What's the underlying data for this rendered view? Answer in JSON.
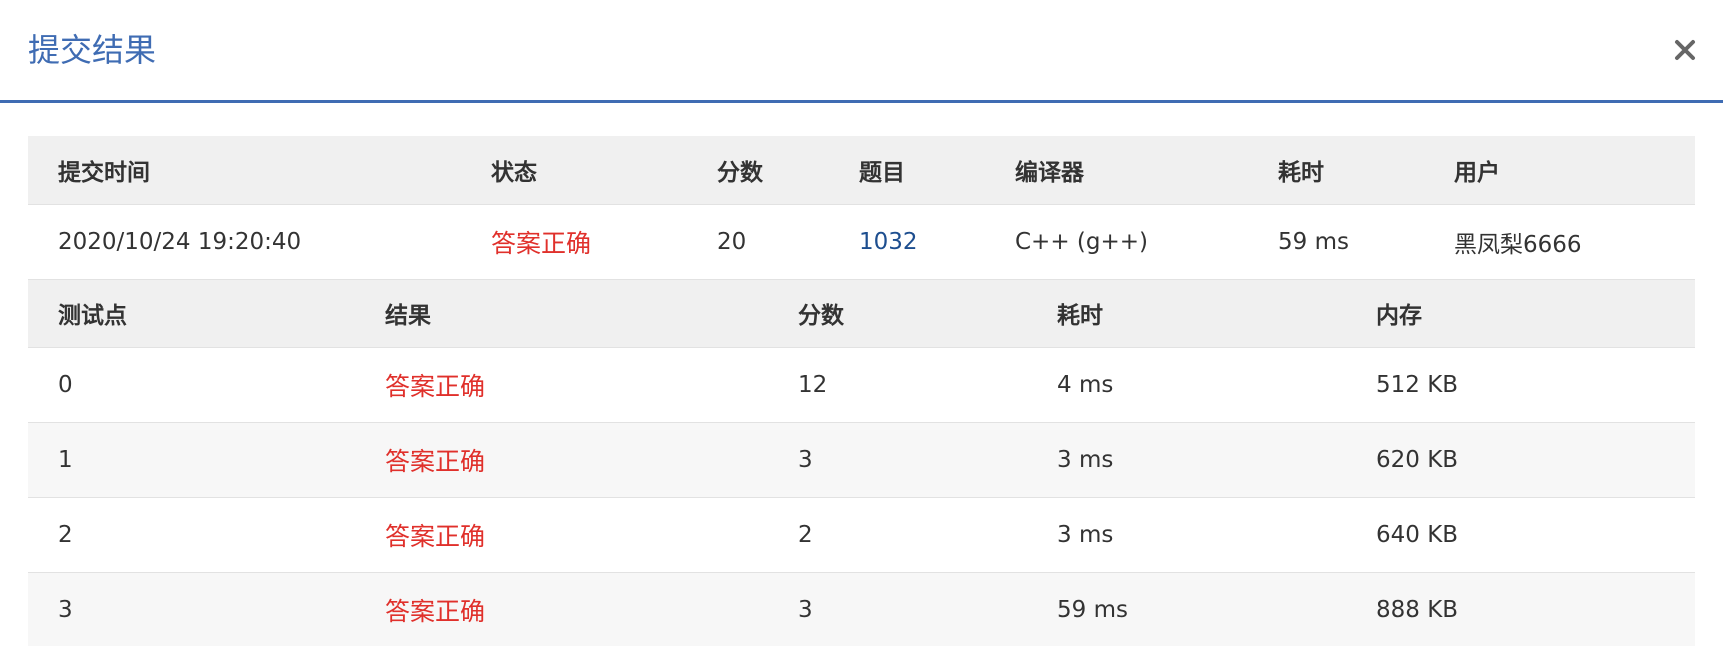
{
  "dialog": {
    "title": "提交结果",
    "close_label": "×"
  },
  "summary": {
    "headers": [
      "提交时间",
      "状态",
      "分数",
      "题目",
      "编译器",
      "耗时",
      "用户"
    ],
    "row": {
      "time": "2020/10/24 19:20:40",
      "status": "答案正确",
      "score": "20",
      "problem": "1032",
      "compiler": "C++ (g++)",
      "elapsed": "59 ms",
      "user": "黑凤梨6666"
    }
  },
  "cases": {
    "headers": [
      "测试点",
      "结果",
      "分数",
      "耗时",
      "内存"
    ],
    "rows": [
      {
        "id": "0",
        "result": "答案正确",
        "score": "12",
        "time": "4 ms",
        "memory": "512 KB"
      },
      {
        "id": "1",
        "result": "答案正确",
        "score": "3",
        "time": "3 ms",
        "memory": "620 KB"
      },
      {
        "id": "2",
        "result": "答案正确",
        "score": "2",
        "time": "3 ms",
        "memory": "640 KB"
      },
      {
        "id": "3",
        "result": "答案正确",
        "score": "3",
        "time": "59 ms",
        "memory": "888 KB"
      }
    ]
  },
  "colors": {
    "accent": "#3f6cb3",
    "success_text": "#e0302b",
    "link": "#1d4e8f",
    "header_bg": "#f0f0f0"
  }
}
